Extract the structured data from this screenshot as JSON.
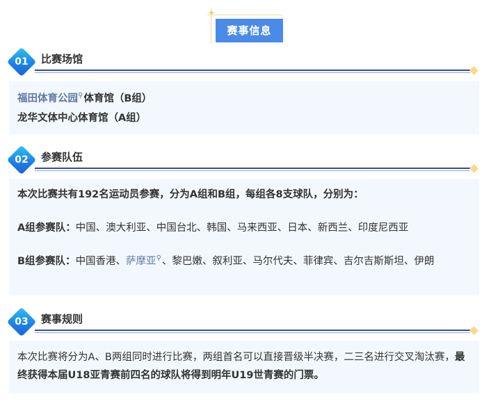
{
  "header": {
    "title": "赛事信息"
  },
  "sections": [
    {
      "num": "01",
      "title": "比赛场馆",
      "line1_link": "福田体育公园",
      "line1_rest": "体育馆（B组）",
      "line2": "龙华文体中心体育馆（A组）"
    },
    {
      "num": "02",
      "title": "参赛队伍",
      "intro": "本次比赛共有192名运动员参赛，分为A组和B组，每组各8支球队，分别为：",
      "groupA_label": "A组参赛队：",
      "groupA_list": "中国、澳大利亚、中国台北、韩国、马来西亚、日本、新西兰、印度尼西亚",
      "groupB_label": "B组参赛队：",
      "groupB_pre": "中国香港、",
      "groupB_link": "萨摩亚",
      "groupB_rest": "、黎巴嫩、叙利亚、马尔代夫、菲律宾、吉尔吉斯斯坦、伊朗"
    },
    {
      "num": "03",
      "title": "赛事规则",
      "text_normal": "本次比赛将分为A、B两组同时进行比赛，两组首名可以直接晋级半决赛，二三名进行交叉淘汰赛，",
      "text_bold": "最终获得本届U18亚青赛前四名的球队将得到明年U19世青赛的门票。"
    }
  ],
  "icons": {
    "search_glyph": "⚲",
    "star_glyph": "✦"
  },
  "colors": {
    "accent": "#4a8be8",
    "rule": "#2d4aa8",
    "box_bg": "#f3f8fe",
    "link": "#5f7aa6"
  }
}
